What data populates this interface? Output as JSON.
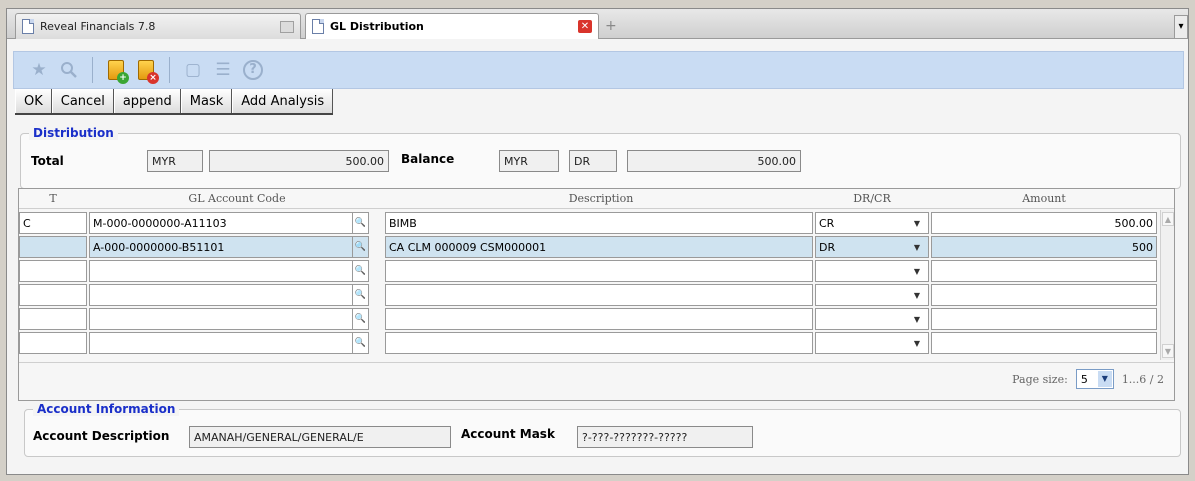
{
  "tabs": [
    {
      "label": "Reveal Financials 7.8",
      "active": false
    },
    {
      "label": "GL Distribution",
      "active": true
    }
  ],
  "toolbar": {
    "icons": [
      "favorite-icon",
      "search-icon",
      "add-folder-icon",
      "delete-folder-icon",
      "new-window-icon",
      "filter-icon",
      "help-icon"
    ],
    "help_glyph": "?"
  },
  "actions": {
    "ok": "OK",
    "cancel": "Cancel",
    "append": "append",
    "mask": "Mask",
    "add_analysis": "Add Analysis"
  },
  "distribution": {
    "legend": "Distribution",
    "total_label": "Total",
    "total_currency": "MYR",
    "total_amount": "500.00",
    "balance_label": "Balance",
    "balance_currency": "MYR",
    "balance_drcr": "DR",
    "balance_amount": "500.00"
  },
  "grid": {
    "columns": {
      "t": "T",
      "gl_code": "GL Account Code",
      "description": "Description",
      "drcr": "DR/CR",
      "amount": "Amount"
    },
    "rows": [
      {
        "t": "C",
        "gl_code": "M-000-0000000-A11103",
        "description": "BIMB",
        "drcr": "CR",
        "amount": "500.00"
      },
      {
        "t": "",
        "gl_code": "A-000-0000000-B51101",
        "description": "CA CLM 000009 CSM000001",
        "drcr": "DR",
        "amount": "500"
      },
      {
        "t": "",
        "gl_code": "",
        "description": "",
        "drcr": "",
        "amount": ""
      },
      {
        "t": "",
        "gl_code": "",
        "description": "",
        "drcr": "",
        "amount": ""
      },
      {
        "t": "",
        "gl_code": "",
        "description": "",
        "drcr": "",
        "amount": ""
      },
      {
        "t": "",
        "gl_code": "",
        "description": "",
        "drcr": "",
        "amount": ""
      }
    ],
    "selected_row": 1,
    "page_size_label": "Page size:",
    "page_size": "5",
    "page_info": "1...6 / 2"
  },
  "account_info": {
    "legend": "Account Information",
    "description_label": "Account Description",
    "description_value": "AMANAH/GENERAL/GENERAL/E",
    "mask_label": "Account Mask",
    "mask_value": "?-???-???????-?????"
  }
}
